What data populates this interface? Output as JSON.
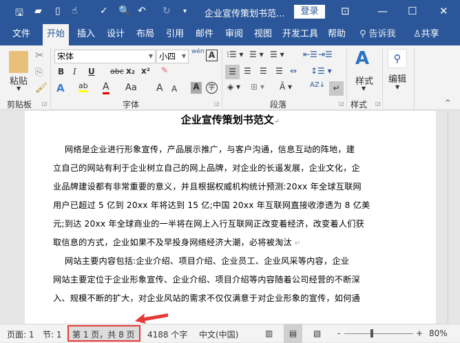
{
  "titlebar": {
    "doc_title": "企业宣传策划书范...",
    "login": "登录"
  },
  "tabs": [
    "文件",
    "开始",
    "插入",
    "设计",
    "布局",
    "引用",
    "邮件",
    "审阅",
    "视图",
    "开发工具",
    "帮助"
  ],
  "tell_me": "告诉我",
  "share": "共享",
  "ribbon": {
    "clipboard": {
      "paste": "粘贴",
      "label": "剪贴板"
    },
    "font": {
      "name": "宋体",
      "size": "小四",
      "label": "字体",
      "bold": "B",
      "italic": "I",
      "underline": "U",
      "strike": "abc",
      "sub": "x₂",
      "sup": "x²",
      "aa": "Aa",
      "wen": "wén"
    },
    "paragraph": {
      "label": "段落"
    },
    "styles": {
      "button": "样式",
      "label": "样式"
    },
    "editing": {
      "button": "编辑"
    }
  },
  "document": {
    "title": "企业宣传策划书范文",
    "lines": [
      "网络是企业进行形象宣传，产品展示推广，与客户沟通，信息互动的阵地，建",
      "立自己的网站有利于企业树立自己的网上品牌，对企业的长遥发展，企业文化，企",
      "业品牌建设都有非常重要的意义，并且根据权威机构统计预测:20xx 年全球互联网",
      "用户已超过 5 亿到 20xx 年将达到 15 亿;中国 20xx 年互联网直接收渗透为 8 亿美",
      "元;到达 20xx 年全球商业的一半将在网上入行互联网正改变着经济，改变着人们获",
      "取信息的方式，企业如果不及早投身网络经济大潮，必将被淘汰",
      "网站主要内容包括:企业介绍、项目介绍、企业员工、企业风采等内容，企业",
      "网站主要定位于企业形象宣传、企业介绍、项目介绍等内容随着公司经营的不断深",
      "入、规模不断的扩大，对企业风站的需求不仅仅满意于对企业形象的宣传，如何通"
    ]
  },
  "status": {
    "page": "页面: 1",
    "section": "节: 1",
    "page_of": "第 1 页，共 8 页",
    "words": "4188 个字",
    "lang": "中文(中国)",
    "zoom": "80%",
    "zoom_minus": "-",
    "zoom_plus": "+"
  },
  "colors": {
    "brand": "#2b579a",
    "highlight": "#e53935"
  }
}
